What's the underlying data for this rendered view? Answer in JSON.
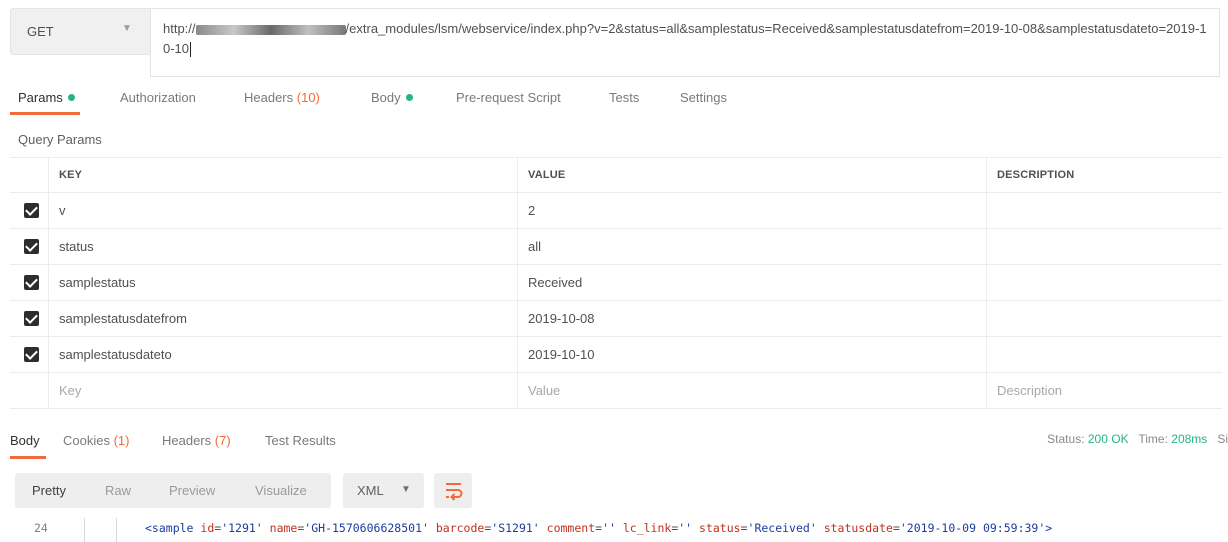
{
  "request": {
    "method": "GET",
    "url_prefix": "http://",
    "url_suffix": "/extra_modules/lsm/webservice/index.php?v=2&status=all&samplestatus=Received&samplestatusdatefrom=2019-10-08&samplestatusdateto=2019-10-10"
  },
  "request_tabs": [
    {
      "label": "Params",
      "indicator": "green-dot",
      "active": true
    },
    {
      "label": "Authorization"
    },
    {
      "label": "Headers",
      "count": "(10)"
    },
    {
      "label": "Body",
      "indicator": "green-dot"
    },
    {
      "label": "Pre-request Script"
    },
    {
      "label": "Tests"
    },
    {
      "label": "Settings"
    }
  ],
  "query_params": {
    "title": "Query Params",
    "columns": {
      "key": "KEY",
      "value": "VALUE",
      "description": "DESCRIPTION"
    },
    "rows": [
      {
        "key": "v",
        "value": "2",
        "checked": true
      },
      {
        "key": "status",
        "value": "all",
        "checked": true
      },
      {
        "key": "samplestatus",
        "value": "Received",
        "checked": true
      },
      {
        "key": "samplestatusdatefrom",
        "value": "2019-10-08",
        "checked": true
      },
      {
        "key": "samplestatusdateto",
        "value": "2019-10-10",
        "checked": true
      }
    ],
    "placeholders": {
      "key": "Key",
      "value": "Value",
      "description": "Description"
    }
  },
  "response_tabs": [
    {
      "label": "Body",
      "active": true
    },
    {
      "label": "Cookies",
      "count": "(1)"
    },
    {
      "label": "Headers",
      "count": "(7)"
    },
    {
      "label": "Test Results"
    }
  ],
  "response_status": {
    "status_label": "Status:",
    "status_value": "200 OK",
    "time_label": "Time:",
    "time_value": "208ms",
    "size_label": "Si"
  },
  "response_toolbar": {
    "views": [
      "Pretty",
      "Raw",
      "Preview",
      "Visualize"
    ],
    "active_view": "Pretty",
    "format": "XML",
    "wrap_icon": "wrap-lines-icon"
  },
  "code": {
    "line_number": "24",
    "tokens": [
      {
        "t": "tag",
        "v": "<sample "
      },
      {
        "t": "attr",
        "v": "id"
      },
      {
        "t": "pun",
        "v": "="
      },
      {
        "t": "str",
        "v": "'1291' "
      },
      {
        "t": "attr",
        "v": "name"
      },
      {
        "t": "pun",
        "v": "="
      },
      {
        "t": "str",
        "v": "'GH-1570606628501' "
      },
      {
        "t": "attr",
        "v": "barcode"
      },
      {
        "t": "pun",
        "v": "="
      },
      {
        "t": "str",
        "v": "'S1291' "
      },
      {
        "t": "attr",
        "v": "comment"
      },
      {
        "t": "pun",
        "v": "="
      },
      {
        "t": "str",
        "v": "'' "
      },
      {
        "t": "attr",
        "v": "lc_link"
      },
      {
        "t": "pun",
        "v": "="
      },
      {
        "t": "str",
        "v": "'' "
      },
      {
        "t": "attr",
        "v": "status"
      },
      {
        "t": "pun",
        "v": "="
      },
      {
        "t": "str",
        "v": "'Received' "
      },
      {
        "t": "attr",
        "v": "statusdate"
      },
      {
        "t": "pun",
        "v": "="
      },
      {
        "t": "str",
        "v": "'2019-10-09 09:59:39'"
      },
      {
        "t": "tag",
        "v": ">"
      }
    ]
  },
  "colors": {
    "accent": "#f26b3a",
    "success": "#26b47f",
    "tag": "#1a3c9e",
    "attr": "#c0321f"
  }
}
